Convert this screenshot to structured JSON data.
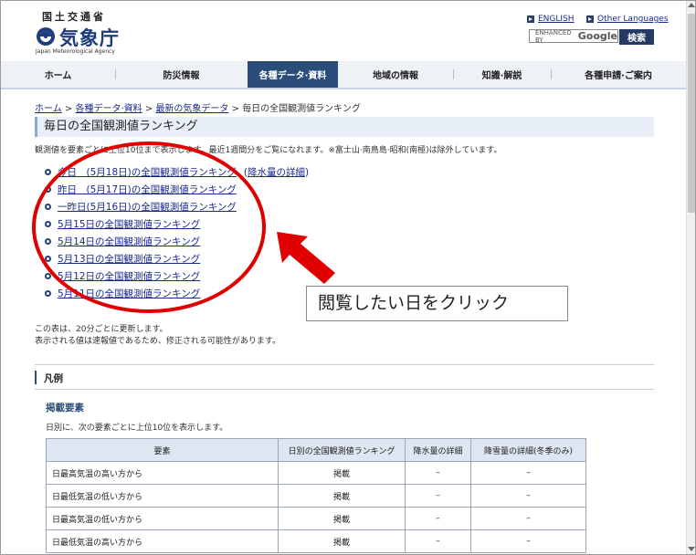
{
  "header": {
    "agency_kanji": "国土交通省",
    "agency_name": "気象庁",
    "agency_en": "Japan Meteorological Agency",
    "english_link": "ENGLISH",
    "other_languages_link": "Other Languages",
    "search_placeholder": "ENHANCED BY",
    "search_google": "Google",
    "search_button": "検索"
  },
  "nav": {
    "items": [
      {
        "label": "ホーム"
      },
      {
        "label": "防災情報"
      },
      {
        "label": "各種データ·資料"
      },
      {
        "label": "地域の情報"
      },
      {
        "label": "知識·解説"
      },
      {
        "label": "各種申請·ご案内"
      }
    ],
    "active_index": 2
  },
  "breadcrumb": {
    "items": [
      "ホーム",
      "各種データ·資料",
      "最新の気象データ"
    ],
    "current": "毎日の全国観測値ランキング",
    "separator": ">"
  },
  "page_title": "毎日の全国観測値ランキング",
  "intro": "観測値を要素ごとに上位10位まで表示します。最近1週間分をご覧になれます。※富士山·南鳥島·昭和(南極)は除外しています。",
  "ranking_links": [
    {
      "label": "今日　(5月18日)の全国観測値ランキング",
      "extra_open": "(",
      "extra_link": "降水量の詳細",
      "extra_close": ")"
    },
    {
      "label": "昨日　(5月17日)の全国観測値ランキング"
    },
    {
      "label": "一昨日(5月16日)の全国観測値ランキング"
    },
    {
      "label": "5月15日の全国観測値ランキング"
    },
    {
      "label": "5月14日の全国観測値ランキング"
    },
    {
      "label": "5月13日の全国観測値ランキング"
    },
    {
      "label": "5月12日の全国観測値ランキング"
    },
    {
      "label": "5月11日の全国観測値ランキング"
    }
  ],
  "notes": {
    "line1": "この表は、20分ごとに更新します。",
    "line2": "表示される値は速報値であるため、修正される可能性があります。"
  },
  "legend": {
    "title": "凡例",
    "subheading": "掲載要素",
    "description": "日別に、次の要素ごとに上位10位を表示します。"
  },
  "elements_table": {
    "headers": [
      "要素",
      "日別の全国観測値ランキング",
      "降水量の詳細",
      "降雪量の詳細(冬季のみ)"
    ],
    "rows": [
      [
        "日最高気温の高い方から",
        "掲載",
        "–",
        "–"
      ],
      [
        "日最低気温の低い方から",
        "掲載",
        "–",
        "–"
      ],
      [
        "日最高気温の低い方から",
        "掲載",
        "–",
        "–"
      ],
      [
        "日最低気温の高い方から",
        "掲載",
        "–",
        "–"
      ]
    ]
  },
  "annotation": {
    "callout_text": "閲覧したい日をクリック",
    "color": "#e00000"
  },
  "colors": {
    "nav_active": "#2b4d79",
    "link": "#1a2a8c",
    "title_bg": "#e8eff7",
    "table_header_bg": "#dde6f1"
  }
}
